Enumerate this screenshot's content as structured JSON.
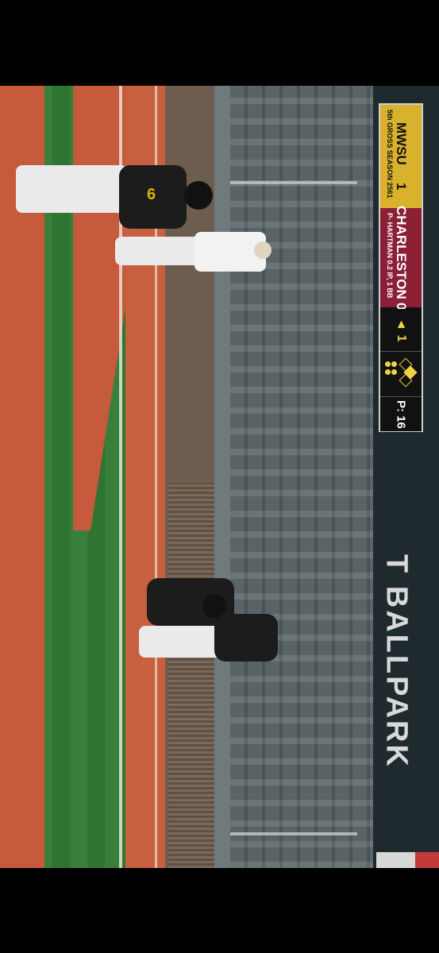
{
  "scorebug": {
    "team1_name": "MWSU",
    "team1_score": "1",
    "team1_sub": "5th GROSS SEASON 2561",
    "team2_name": "CHARLESTON",
    "team2_score": "0",
    "team2_sub": "P- HARTMAN 0.2 IP, 1 BB",
    "inning": "▲ 1",
    "pitch_count": "P: 16"
  },
  "venue": {
    "wall_text": "T BALLPARK"
  },
  "player": {
    "jersey_number": "6"
  },
  "colors": {
    "team1": "#d9b22d",
    "team2": "#8a1f36",
    "grass": "#2f7a33",
    "dirt": "#c65a3c"
  }
}
